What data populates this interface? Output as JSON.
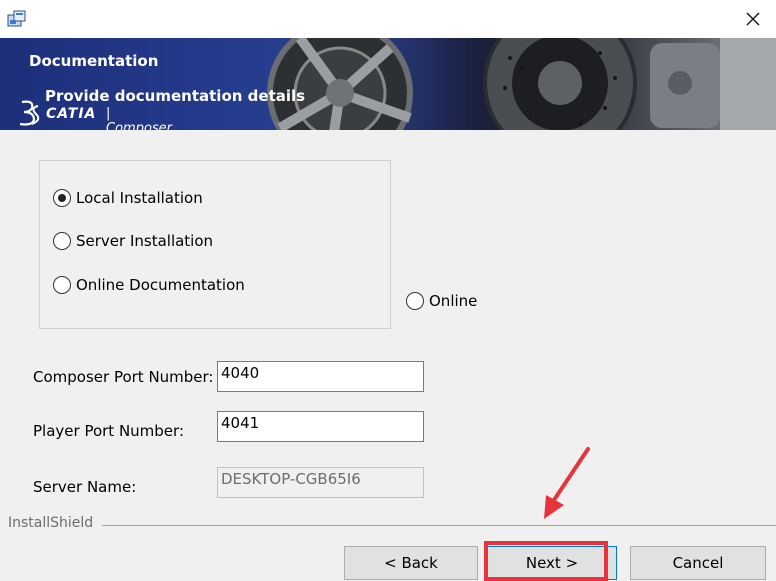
{
  "window": {
    "app_icon": "installer-icon",
    "close_icon": "close-icon"
  },
  "banner": {
    "title": "Documentation",
    "subtitle": "Provide documentation details",
    "logo_brand": "CATIA",
    "logo_product": "Composer"
  },
  "options": {
    "items": [
      {
        "label": "Local Installation",
        "checked": true
      },
      {
        "label": "Server Installation",
        "checked": false
      },
      {
        "label": "Online Documentation",
        "checked": false
      }
    ],
    "extra": {
      "label": "Online",
      "checked": false
    }
  },
  "fields": {
    "composer_port": {
      "label": "Composer Port Number:",
      "value": "4040"
    },
    "player_port": {
      "label": "Player Port Number:",
      "value": "4041"
    },
    "server_name": {
      "label": "Server Name:",
      "value": "DESKTOP-CGB65I6"
    }
  },
  "footer": {
    "brand": "InstallShield",
    "back_label": "< Back",
    "next_label": "Next >",
    "cancel_label": "Cancel"
  },
  "colors": {
    "highlight": "#e8323c",
    "banner": "#253b8c"
  }
}
